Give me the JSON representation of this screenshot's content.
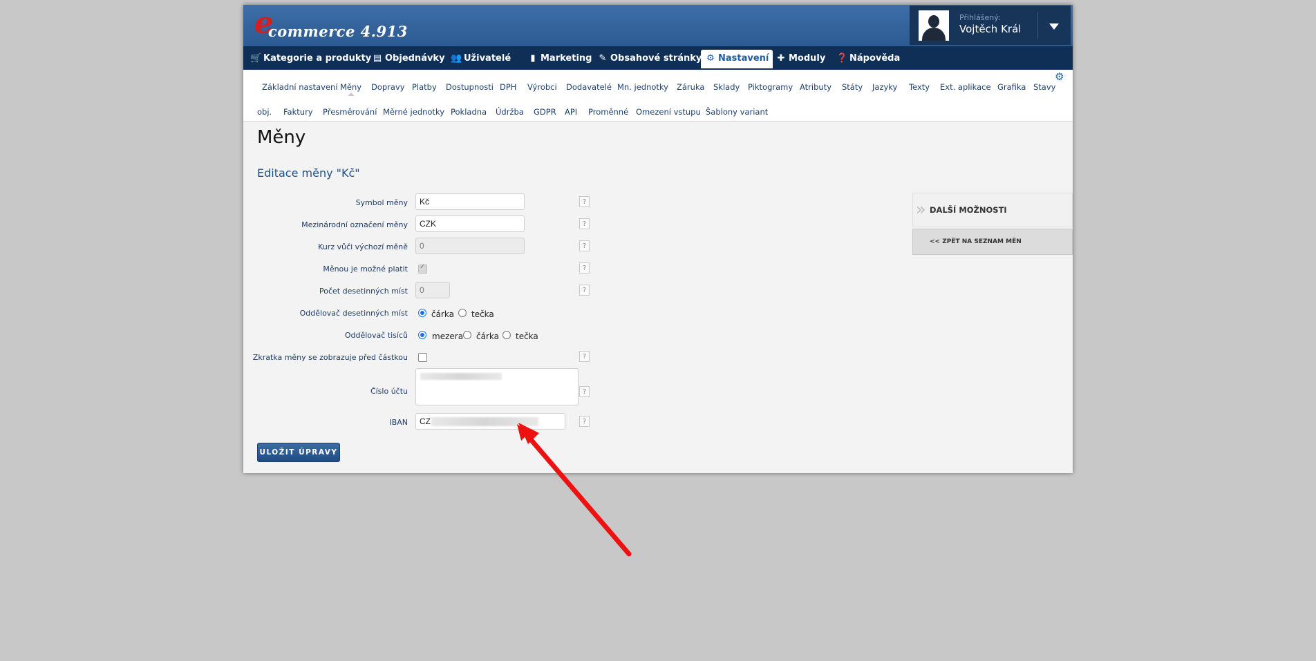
{
  "app": {
    "logo_letter": "e",
    "logo_text": "commerce 4.913",
    "user_label": "Přihlášený:",
    "user_name": "Vojtěch Král"
  },
  "main_nav": [
    {
      "label": "Kategorie a produkty",
      "icon": "cart-icon"
    },
    {
      "label": "Objednávky",
      "icon": "orders-icon"
    },
    {
      "label": "Uživatelé",
      "icon": "users-icon"
    },
    {
      "label": "Marketing",
      "icon": "chart-icon"
    },
    {
      "label": "Obsahové stránky",
      "icon": "edit-icon"
    },
    {
      "label": "Nastavení",
      "icon": "gear-icon",
      "active": true
    },
    {
      "label": "Moduly",
      "icon": "puzzle-icon"
    },
    {
      "label": "Nápověda",
      "icon": "help-icon"
    }
  ],
  "sub_nav": [
    "Základní nastavení",
    "Měny",
    "Dopravy",
    "Platby",
    "Dostupnosti",
    "DPH",
    "Výrobci",
    "Dodavatelé",
    "Mn. jednotky",
    "Záruka",
    "Sklady",
    "Piktogramy",
    "Atributy",
    "Státy",
    "Jazyky",
    "Texty",
    "Ext. aplikace",
    "Grafika",
    "Stavy",
    "obj.",
    "Faktury",
    "Přesměrování",
    "Měrné jednotky",
    "Pokladna",
    "Údržba",
    "GDPR",
    "API",
    "Proměnné",
    "Omezení vstupu",
    "Šablony variant"
  ],
  "page": {
    "title": "Měny",
    "section_title": "Editace měny \"Kč\""
  },
  "form": {
    "symbol_label": "Symbol měny",
    "symbol_value": "Kč",
    "intl_label": "Mezinárodní označení měny",
    "intl_value": "CZK",
    "rate_label": "Kurz vůči výchozí měně",
    "rate_value": "0",
    "payable_label": "Měnou je možné platit",
    "payable_checked": true,
    "decimals_label": "Počet desetinných míst",
    "decimals_value": "0",
    "dec_sep_label": "Oddělovač desetinných míst",
    "dec_sep_options": [
      "čárka",
      "tečka"
    ],
    "dec_sep_selected": "čárka",
    "thousands_label": "Oddělovač tisíců",
    "thousands_options": [
      "mezera",
      "čárka",
      "tečka"
    ],
    "thousands_selected": "mezera",
    "prefix_label": "Zkratka měny se zobrazuje před částkou",
    "prefix_checked": false,
    "account_label": "Číslo účtu",
    "iban_label": "IBAN",
    "iban_value": "CZ",
    "help_glyph": "?",
    "save_label": "ULOŽIT ÚPRAVY"
  },
  "sidebar": {
    "heading": "DALŠÍ MOŽNOSTI",
    "back_link": "<< ZPĚT NA SEZNAM MĚN"
  },
  "colors": {
    "header": "#3e6ea8",
    "nav": "#0f2f57",
    "annotation_arrow": "#ee1111",
    "radio_accent": "#1a73e8"
  }
}
